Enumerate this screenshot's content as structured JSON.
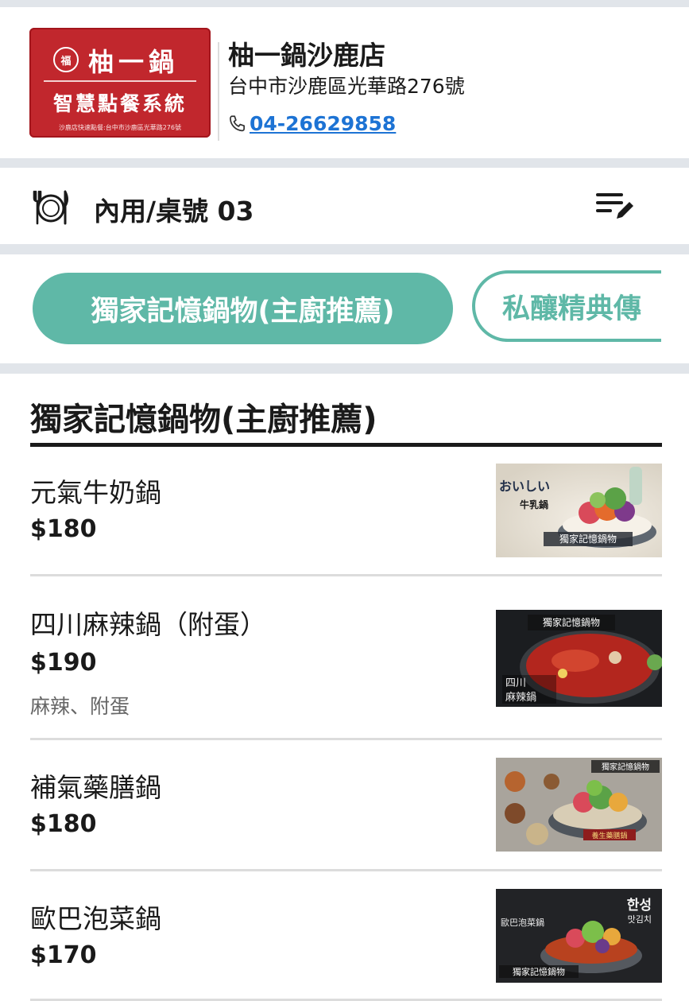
{
  "store": {
    "logo": {
      "seal": "福",
      "brand": "柚一鍋",
      "subtitle": "智慧點餐系統",
      "fine_print": "沙鹿店快速點餐:台中市沙鹿區光華路276號"
    },
    "name": "柚一鍋沙鹿店",
    "address": "台中市沙鹿區光華路276號",
    "phone": "04-26629858"
  },
  "dining": {
    "mode_label": "內用/桌號 03"
  },
  "categories": [
    {
      "label": "獨家記憶鍋物(主廚推薦)",
      "active": true
    },
    {
      "label": "私釀精典傳",
      "active": false
    }
  ],
  "menu": {
    "section_title": "獨家記憶鍋物(主廚推薦)",
    "items": [
      {
        "name": "元氣牛奶鍋",
        "price": "$180",
        "description": "",
        "image": {
          "caption": "獨家記憶鍋物",
          "vertical_text": "牛乳鍋",
          "side_text": "おいしい"
        }
      },
      {
        "name": "四川麻辣鍋（附蛋）",
        "price": "$190",
        "description": "麻辣、附蛋",
        "image": {
          "caption": "獨家記憶鍋物",
          "overlay_1": "四川",
          "overlay_2": "麻辣鍋"
        }
      },
      {
        "name": "補氣藥膳鍋",
        "price": "$180",
        "description": "",
        "image": {
          "caption": "獨家記憶鍋物",
          "tag": "養生藥膳鍋"
        }
      },
      {
        "name": "歐巴泡菜鍋",
        "price": "$170",
        "description": "",
        "image": {
          "caption": "獨家記憶鍋物",
          "vertical_text": "歐巴泡菜鍋",
          "korean": "한성",
          "korean_sub": "맛김치"
        }
      }
    ]
  },
  "colors": {
    "accent": "#5fb8a7",
    "logo_red": "#c1272d",
    "link_blue": "#1d73d4",
    "divider": "#e1e5ea"
  }
}
